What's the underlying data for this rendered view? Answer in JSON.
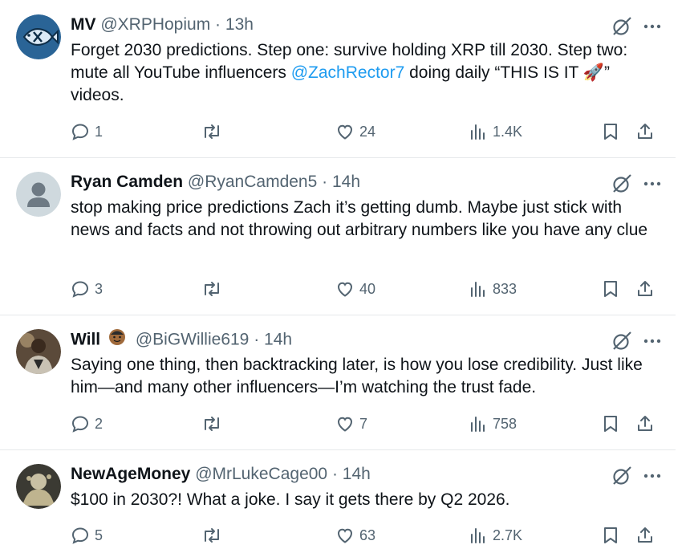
{
  "tweets": [
    {
      "name": "MV",
      "handle": "@XRPHopium",
      "dot": "·",
      "time": "13h",
      "text_before": "Forget 2030 predictions. Step one: survive holding XRP till 2030. Step two: mute all YouTube influencers ",
      "mention": "@ZachRector7",
      "text_after": " doing daily “THIS IS IT 🚀” videos.",
      "replies": "1",
      "reposts": "",
      "likes": "24",
      "views": "1.4K",
      "avatar_icon": "fish-logo-avatar"
    },
    {
      "name": "Ryan Camden",
      "handle": "@RyanCamden5",
      "dot": "·",
      "time": "14h",
      "text": "stop making price predictions Zach it’s getting dumb. Maybe just stick with news and facts and not throwing out arbitrary numbers like you have any clue",
      "replies": "3",
      "reposts": "",
      "likes": "40",
      "views": "833",
      "avatar_icon": "default-profile-avatar"
    },
    {
      "name": "Will",
      "handle": "@BiGWillie619",
      "dot": "·",
      "time": "14h",
      "text": "Saying one thing, then backtracking later, is how you lose credibility. Just like him—and many other influencers—I’m watching the trust fade.",
      "replies": "2",
      "reposts": "",
      "likes": "7",
      "views": "758",
      "avatar_icon": "photo-avatar"
    },
    {
      "name": "NewAgeMoney",
      "handle": "@MrLukeCage00",
      "dot": "·",
      "time": "14h",
      "text": "$100 in 2030?! What a joke. I say it gets there by Q2 2026.",
      "replies": "5",
      "reposts": "",
      "likes": "63",
      "views": "2.7K",
      "avatar_icon": "photo-avatar"
    }
  ],
  "colors": {
    "text": "#0f1419",
    "secondary": "#536471",
    "mention": "#1d9bf0",
    "divider": "#e6e9eb"
  }
}
